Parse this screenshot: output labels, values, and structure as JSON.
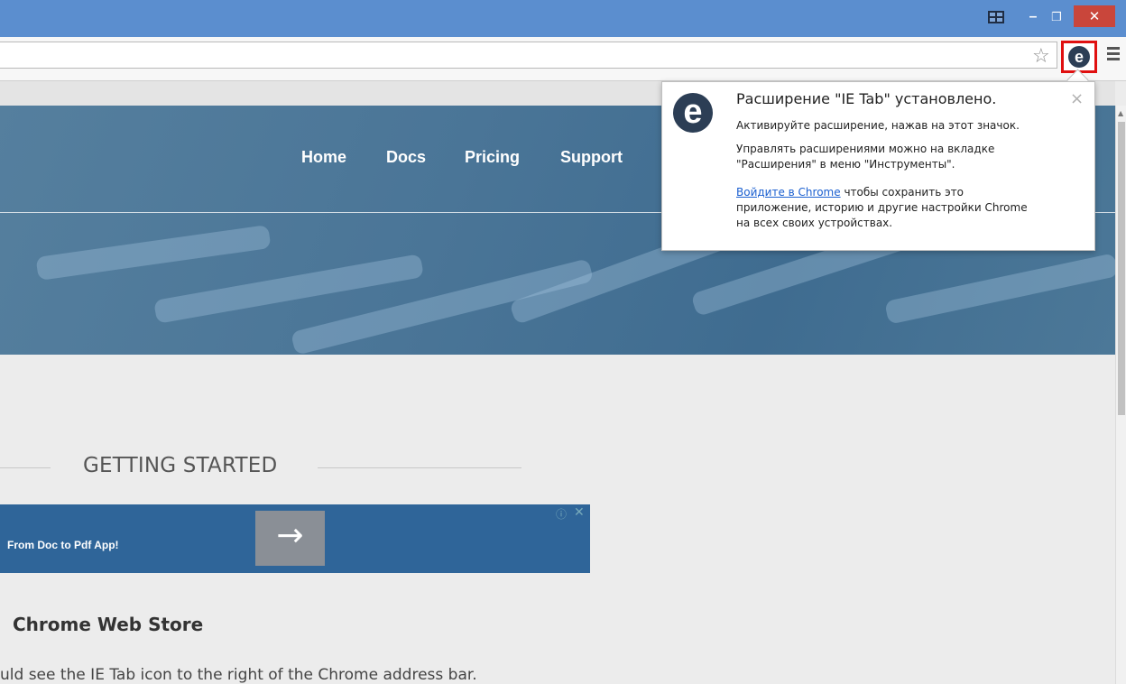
{
  "window": {
    "minimize_glyph": "–",
    "maximize_glyph": "❐",
    "close_glyph": "✕"
  },
  "toolbar": {
    "star_glyph": "☆",
    "extension_icon_glyph": "e"
  },
  "site_nav": {
    "items": [
      "Home",
      "Docs",
      "Pricing",
      "Support"
    ]
  },
  "popup": {
    "logo_glyph": "e",
    "close_glyph": "×",
    "title": "Расширение \"IE Tab\" установлено.",
    "line1": "Активируйте расширение, нажав на этот значок.",
    "line2a": "Управлять расширениями можно на вкладке",
    "line2b": "\"Расширения\" в меню \"Инструменты\".",
    "signin_link": "Войдите в Chrome",
    "line3a": " чтобы сохранить это",
    "line3b": "приложение, историю и другие настройки Chrome",
    "line3c": "на всех своих устройствах."
  },
  "content": {
    "getting_started": "GETTING STARTED",
    "ad_text": "From Doc to Pdf App!",
    "ad_arrow": "→",
    "ad_info": "ⓘ",
    "ad_close": "✕",
    "cws_heading": "Chrome Web Store",
    "partial_text": "uld see the IE Tab icon to the right of the Chrome address bar."
  },
  "colors": {
    "titlebar": "#5b8ecf",
    "hero": "#4a7597",
    "highlight": "#e01010",
    "ad": "#2f6599"
  }
}
